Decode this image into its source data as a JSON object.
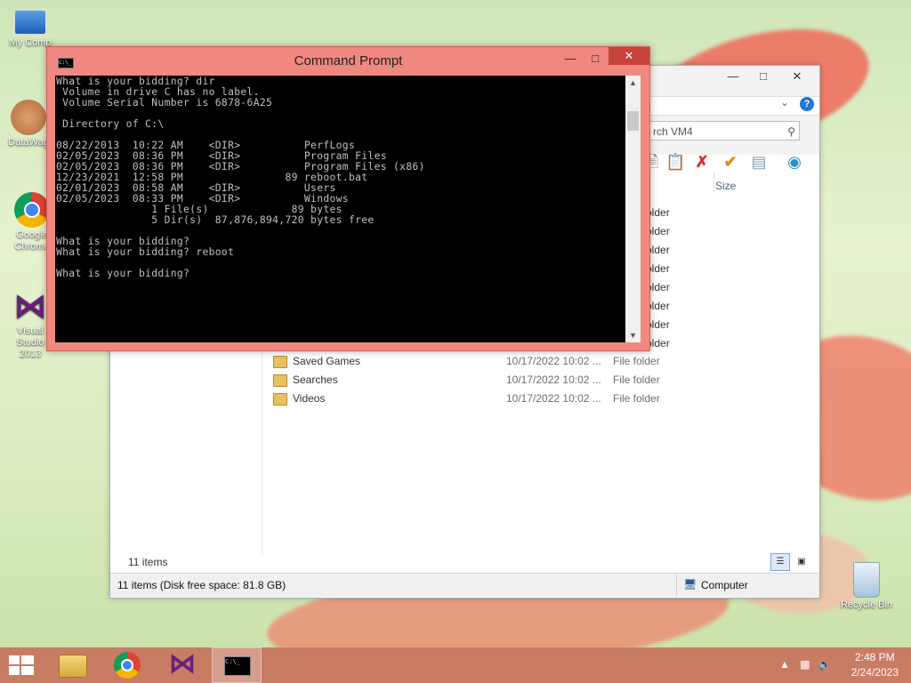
{
  "desktop": {
    "icons": [
      {
        "label": "My Comp",
        "icon": "computer-icon"
      },
      {
        "label": "DataWag",
        "icon": "datawag-icon"
      },
      {
        "label": "Google Chrome",
        "icon": "chrome-icon"
      },
      {
        "label": "Visual Studio 2013",
        "icon": "visual-studio-icon"
      },
      {
        "label": "Recycle Bin",
        "icon": "recycle-bin-icon"
      }
    ]
  },
  "explorer": {
    "search_placeholder": "rch VM4",
    "column_size": "Size",
    "partial_types": [
      "older",
      "older",
      "older",
      "older",
      "older",
      "older",
      "older",
      "older"
    ],
    "rows": [
      {
        "name": "Saved Games",
        "date": "10/17/2022 10:02 ...",
        "type": "File folder"
      },
      {
        "name": "Searches",
        "date": "10/17/2022 10:02 ...",
        "type": "File folder"
      },
      {
        "name": "Videos",
        "date": "10/17/2022 10:02 ...",
        "type": "File folder"
      }
    ],
    "item_count": "11 items",
    "status_left": "11 items (Disk free space: 81.8 GB)",
    "status_right": "Computer"
  },
  "cmd": {
    "title": "Command Prompt",
    "console_text": "What is your bidding? dir\n Volume in drive C has no label.\n Volume Serial Number is 6878-6A25\n\n Directory of C:\\\n\n08/22/2013  10:22 AM    <DIR>          PerfLogs\n02/05/2023  08:36 PM    <DIR>          Program Files\n02/05/2023  08:36 PM    <DIR>          Program Files (x86)\n12/23/2021  12:58 PM                89 reboot.bat\n02/01/2023  08:58 AM    <DIR>          Users\n02/05/2023  08:33 PM    <DIR>          Windows\n               1 File(s)             89 bytes\n               5 Dir(s)  87,876,894,720 bytes free\n\nWhat is your bidding?\nWhat is your bidding? reboot\n\nWhat is your bidding?"
  },
  "taskbar": {
    "time": "2:48 PM",
    "date": "2/24/2023"
  }
}
